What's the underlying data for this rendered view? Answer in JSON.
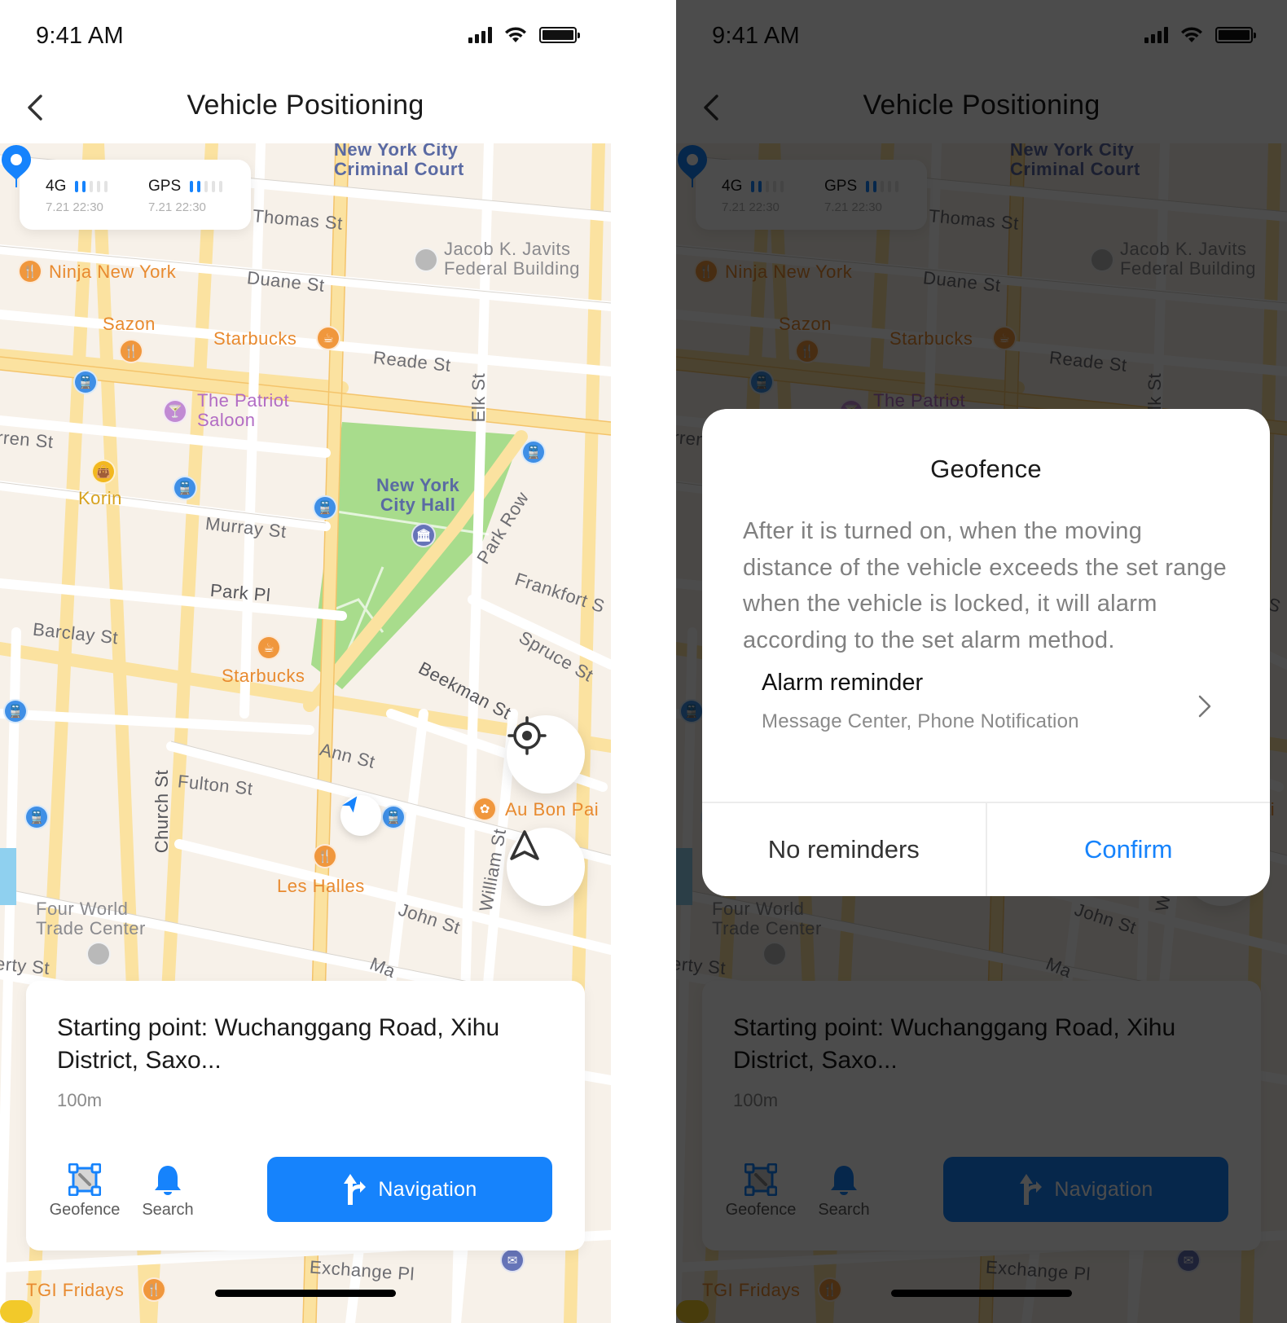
{
  "status_bar": {
    "time": "9:41 AM"
  },
  "header": {
    "title": "Vehicle Positioning",
    "back_icon": "chevron-left-icon"
  },
  "signal": {
    "network": {
      "label": "4G",
      "bars_filled": 2,
      "bars_total": 5,
      "time": "7.21 22:30"
    },
    "gps": {
      "label": "GPS",
      "bars_filled": 2,
      "bars_total": 5,
      "time": "7.21 22:30"
    }
  },
  "map": {
    "labels": {
      "criminal_court": "New York City\nCriminal Court",
      "thomas_st": "Thomas St",
      "javits": "Jacob K. Javits\nFederal Building",
      "ninja": "Ninja New York",
      "duane_st": "Duane St",
      "sazon": "Sazon",
      "starbucks1": "Starbucks",
      "reade_st": "Reade St",
      "elk_st": "Elk St",
      "patriot": "The Patriot\nSaloon",
      "warren_st": "rren St",
      "korin": "Korin",
      "city_hall": "New York\nCity Hall",
      "murray_st": "Murray St",
      "park_row": "Park Row",
      "park_pl": "Park Pl",
      "frankfort_st": "Frankfort S",
      "barclay_st": "Barclay St",
      "spruce_st": "Spruce St",
      "starbucks2": "Starbucks",
      "beekman_st": "Beekman St",
      "ann_st": "Ann St",
      "church_st": "Church St",
      "fulton_st": "Fulton St",
      "au_bon_pain": "Au Bon Pai",
      "les_halles": "Les Halles",
      "william_st": "William St",
      "john_st": "John St",
      "four_wtc": "Four World\nTrade Center",
      "liberty_st": "erty St",
      "maiden": "Ma",
      "exchange_pl": "Exchange Pl",
      "tgi_fridays": "TGI Fridays"
    }
  },
  "info_card": {
    "title": "Starting point: Wuchanggang Road, Xihu District, Saxo...",
    "distance": "100m",
    "actions": [
      {
        "label": "Geofence",
        "icon": "geofence-icon"
      },
      {
        "label": "Search",
        "icon": "bell-icon"
      }
    ],
    "navigation_label": "Navigation"
  },
  "floating_buttons": {
    "locate_icon": "crosshair-icon",
    "compass_icon": "navigation-arrow-icon"
  },
  "dialog": {
    "title": "Geofence",
    "body": "After it is turned on, when the moving distance of the vehicle exceeds the set range when the vehicle is locked, it will alarm according to the set alarm method.",
    "alarm_title": "Alarm reminder",
    "alarm_value": "Message Center, Phone Notification",
    "cancel_label": "No reminders",
    "confirm_label": "Confirm"
  },
  "colors": {
    "accent": "#1683fc",
    "park": "#a8dc8c",
    "map_bg": "#f7f1e9",
    "overlay": "rgba(0,0,0,0.70)"
  }
}
